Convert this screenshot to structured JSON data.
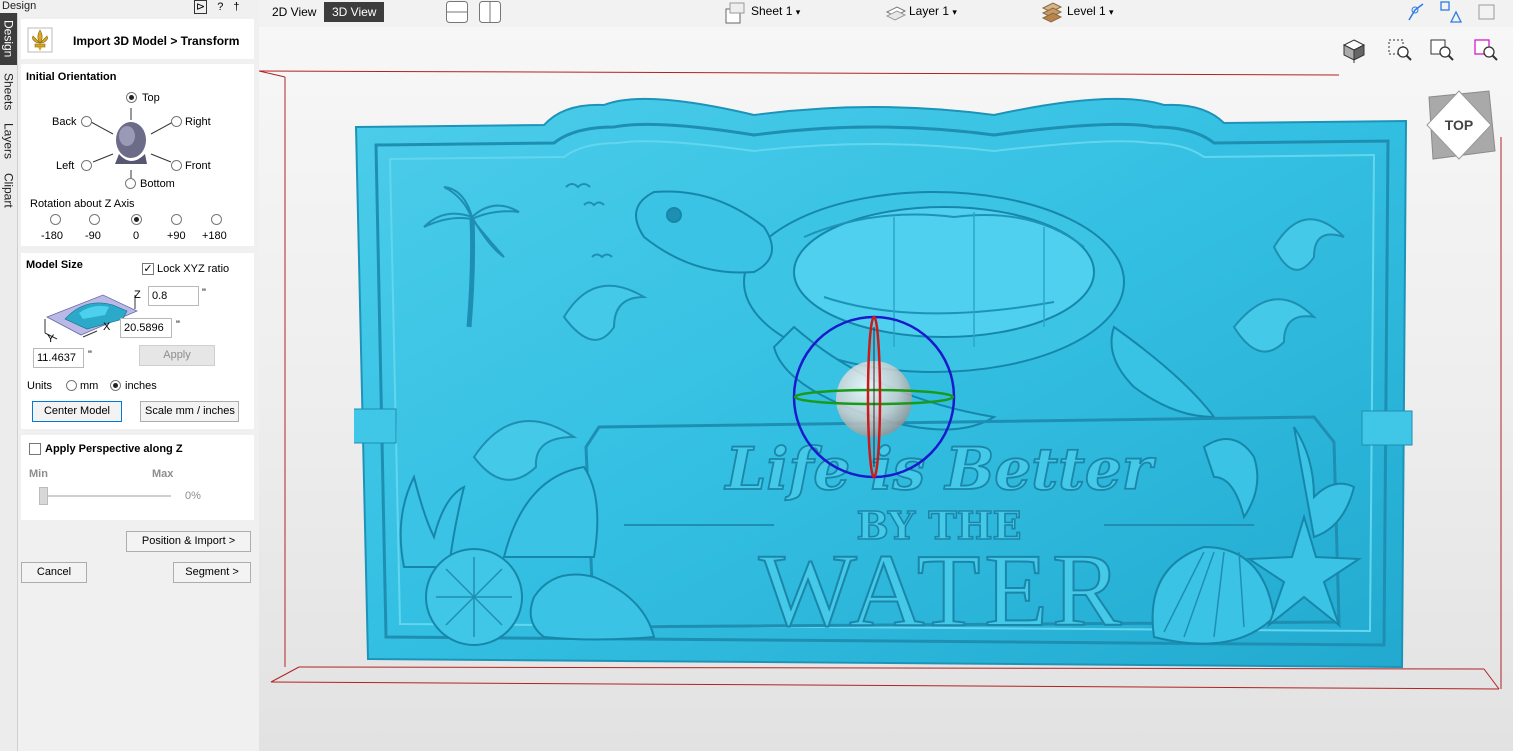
{
  "panel": {
    "title": "Design",
    "header_icons": {
      "pin": "⊳",
      "help": "?",
      "pushpin": "†"
    },
    "header": {
      "title": "Import 3D Model > Transform"
    }
  },
  "side_tabs": [
    "Design",
    "Sheets",
    "Layers",
    "Clipart"
  ],
  "orientation": {
    "heading": "Initial Orientation",
    "options": {
      "top": "Top",
      "back": "Back",
      "right": "Right",
      "left": "Left",
      "front": "Front",
      "bottom": "Bottom"
    },
    "selected": "Top",
    "rotation_label": "Rotation about Z Axis",
    "rotation_options": [
      "-180",
      "-90",
      "0",
      "+90",
      "+180"
    ],
    "rotation_selected": "0"
  },
  "model_size": {
    "heading": "Model Size",
    "lock_label": "Lock XYZ ratio",
    "lock_checked": true,
    "z_label": "Z",
    "z_value": "0.8",
    "x_label": "X",
    "x_value": "20.5896",
    "y_label": "Y",
    "y_value": "11.4637",
    "unit_mark": "\"",
    "apply_label": "Apply",
    "units_label": "Units",
    "unit_mm": "mm",
    "unit_inches": "inches",
    "unit_selected": "inches",
    "center_label": "Center Model",
    "scale_label": "Scale mm / inches"
  },
  "perspective": {
    "label": "Apply Perspective along Z",
    "checked": false,
    "min_label": "Min",
    "max_label": "Max",
    "value": "0%",
    "level": 0
  },
  "footer": {
    "position_import": "Position & Import >",
    "cancel": "Cancel",
    "segment": "Segment >"
  },
  "toolbar": {
    "view_2d": "2D View",
    "view_3d": "3D View",
    "active_view": "3D View",
    "sheet": "Sheet 1",
    "layer": "Layer 1",
    "level": "Level 1",
    "caret": "▾"
  },
  "viewport": {
    "nav_cube_label": "TOP",
    "model_text": {
      "line1": "Life is Better",
      "line2": "BY THE",
      "line3": "WATER"
    },
    "colors": {
      "model": "#33bfe2",
      "model_dark": "#1e93b8",
      "bounding_box": "#b22222",
      "gizmo_blue": "#1a1acc",
      "gizmo_red": "#cc1a1a",
      "gizmo_green": "#1a9a1a"
    }
  }
}
